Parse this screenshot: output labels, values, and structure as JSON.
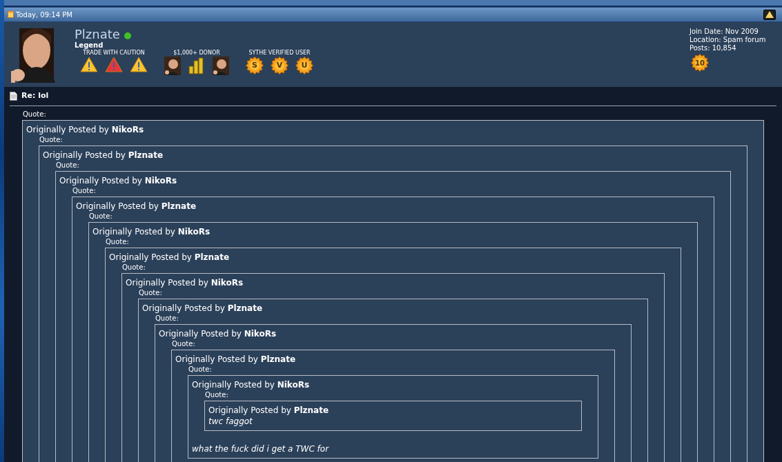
{
  "post": {
    "date": "Today, 09:14 PM",
    "user": {
      "name": "Plznate",
      "online": true,
      "title": "Legend",
      "badge_groups": [
        {
          "label": "TRADE WITH CAUTION",
          "badges": [
            {
              "kind": "warning",
              "color": "#f7c531"
            },
            {
              "kind": "warning",
              "color": "#e8343a"
            },
            {
              "kind": "warning",
              "color": "#f7c531"
            }
          ]
        },
        {
          "label": "$1,000+ DONOR",
          "badges": [
            {
              "kind": "avatar"
            },
            {
              "kind": "coins"
            },
            {
              "kind": "avatar"
            }
          ]
        },
        {
          "label": "SYTHE VERIFIED USER",
          "badges": [
            {
              "kind": "sun",
              "letter": "S"
            },
            {
              "kind": "sun",
              "letter": "V"
            },
            {
              "kind": "sun",
              "letter": "U"
            }
          ]
        }
      ],
      "details": [
        "Join Date: Nov 2009",
        "Location: Spam forum",
        "Posts: 10,854"
      ],
      "post_badge": "10"
    },
    "title": "Re: lol",
    "quote": {
      "label": "Quote:",
      "header": "Originally Posted by **NikoRs**",
      "quote": {
        "label": "Quote:",
        "header": "Originally Posted by **Plznate**",
        "quote": {
          "label": "Quote:",
          "header": "Originally Posted by **NikoRs**",
          "quote": {
            "label": "Quote:",
            "header": "Originally Posted by **Plznate**",
            "quote": {
              "label": "Quote:",
              "header": "Originally Posted by **NikoRs**",
              "quote": {
                "label": "Quote:",
                "header": "Originally Posted by **Plznate**",
                "quote": {
                  "label": "Quote:",
                  "header": "Originally Posted by **NikoRs**",
                  "quote": {
                    "label": "Quote:",
                    "header": "Originally Posted by **Plznate**",
                    "quote": {
                      "label": "Quote:",
                      "header": "Originally Posted by **NikoRs**",
                      "quote": {
                        "label": "Quote:",
                        "header": "Originally Posted by **Plznate**",
                        "quote": {
                          "label": "Quote:",
                          "header": "Originally Posted by **NikoRs**",
                          "quote": {
                            "label": "Quote:",
                            "header": "Originally Posted by **Plznate**",
                            "message": "twc faggot"
                          },
                          "message": "what the fuck did i get a TWC for"
                        }
                      }
                    }
                  }
                }
              }
            }
          }
        }
      }
    }
  }
}
